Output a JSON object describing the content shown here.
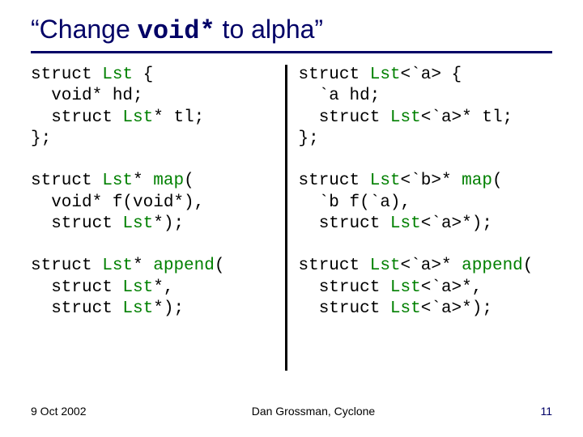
{
  "title_pre": "“Change ",
  "title_code": "void*",
  "title_post": " to alpha”",
  "left": {
    "l1a": "struct ",
    "l1b": "Lst",
    "l1c": " {",
    "l2": "  void* hd;",
    "l3a": "  struct ",
    "l3b": "Lst",
    "l3c": "* tl;",
    "l4": "};",
    "l5": "",
    "l6a": "struct ",
    "l6b": "Lst",
    "l6c": "* ",
    "l6d": "map",
    "l6e": "(",
    "l7": "  void* f(void*),",
    "l8a": "  struct ",
    "l8b": "Lst",
    "l8c": "*);",
    "l9": "",
    "l10a": "struct ",
    "l10b": "Lst",
    "l10c": "* ",
    "l10d": "append",
    "l10e": "(",
    "l11a": "  struct ",
    "l11b": "Lst",
    "l11c": "*,",
    "l12a": "  struct ",
    "l12b": "Lst",
    "l12c": "*);"
  },
  "right": {
    "l1a": "struct ",
    "l1b": "Lst",
    "l1c": "<`a> {",
    "l2": "  `a hd;",
    "l3a": "  struct ",
    "l3b": "Lst",
    "l3c": "<`a>* tl;",
    "l4": "};",
    "l5": "",
    "l6a": "struct ",
    "l6b": "Lst",
    "l6c": "<`b>* ",
    "l6d": "map",
    "l6e": "(",
    "l7": "  `b f(`a),",
    "l8a": "  struct ",
    "l8b": "Lst",
    "l8c": "<`a>*);",
    "l9": "",
    "l10a": "struct ",
    "l10b": "Lst",
    "l10c": "<`a>* ",
    "l10d": "append",
    "l10e": "(",
    "l11a": "  struct ",
    "l11b": "Lst",
    "l11c": "<`a>*,",
    "l12a": "  struct ",
    "l12b": "Lst",
    "l12c": "<`a>*);"
  },
  "footer_date": "9 Oct 2002",
  "footer_center": "Dan Grossman, Cyclone",
  "footer_page": "11"
}
